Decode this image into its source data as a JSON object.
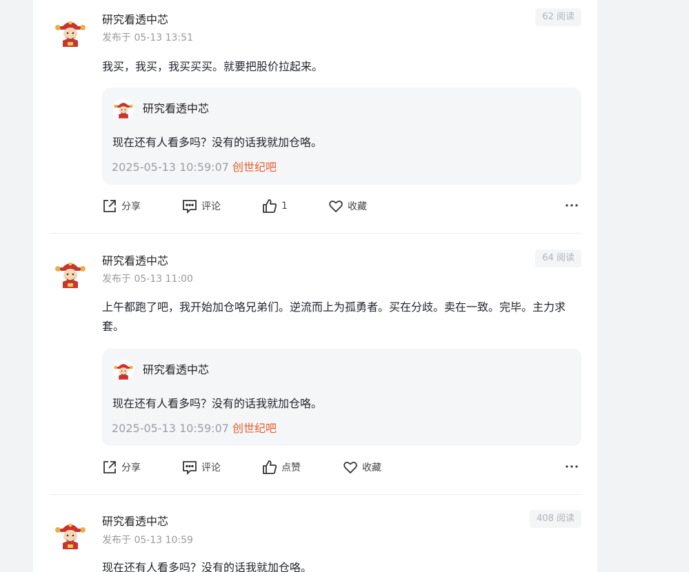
{
  "posts": [
    {
      "author": "研究看透中芯",
      "meta": "发布于 05-13 13:51",
      "reads": "62 阅读",
      "body": "我买，我买，我买买买。就要把股价拉起来。",
      "quote": {
        "author": "研究看透中芯",
        "text": "现在还有人看多吗？没有的话我就加仓咯。",
        "time": "2025-05-13 10:59:07",
        "source": "创世纪吧"
      },
      "actions": {
        "share": "分享",
        "comment": "评论",
        "like": "1",
        "favorite": "收藏"
      }
    },
    {
      "author": "研究看透中芯",
      "meta": "发布于 05-13 11:00",
      "reads": "64 阅读",
      "body": "上午都跑了吧，我开始加仓咯兄弟们。逆流而上为孤勇者。买在分歧。卖在一致。完毕。主力求套。",
      "quote": {
        "author": "研究看透中芯",
        "text": "现在还有人看多吗？没有的话我就加仓咯。",
        "time": "2025-05-13 10:59:07",
        "source": "创世纪吧"
      },
      "actions": {
        "share": "分享",
        "comment": "评论",
        "like": "点赞",
        "favorite": "收藏"
      }
    },
    {
      "author": "研究看透中芯",
      "meta": "发布于 05-13 10:59",
      "reads": "408 阅读",
      "body": "现在还有人看多吗？没有的话我就加仓咯。"
    }
  ],
  "colors": {
    "accent": "#ea5b2c",
    "muted": "#999999",
    "card": "#f5f6f8"
  },
  "icons": {
    "avatar": "caishen-avatar",
    "share": "share-icon",
    "comment": "comment-icon",
    "like": "thumbs-up-icon",
    "favorite": "heart-icon",
    "more": "more-icon"
  }
}
